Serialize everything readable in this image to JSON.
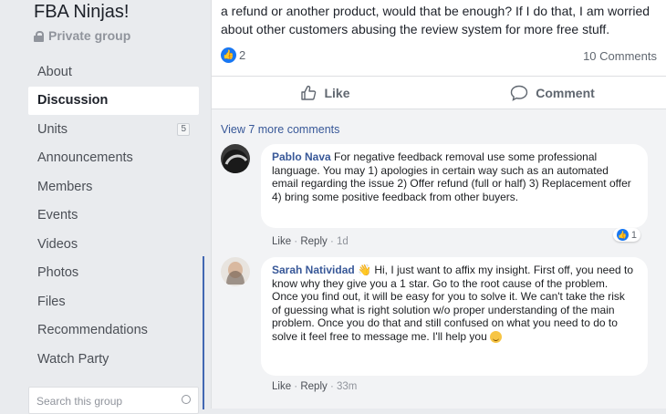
{
  "group": {
    "title": "FBA Ninjas!",
    "privacy": "Private group",
    "nav": [
      {
        "label": "About",
        "active": false
      },
      {
        "label": "Discussion",
        "active": true
      },
      {
        "label": "Units",
        "badge": "5",
        "active": false
      },
      {
        "label": "Announcements",
        "active": false
      },
      {
        "label": "Members",
        "active": false
      },
      {
        "label": "Events",
        "active": false
      },
      {
        "label": "Videos",
        "active": false
      },
      {
        "label": "Photos",
        "active": false
      },
      {
        "label": "Files",
        "active": false
      },
      {
        "label": "Recommendations",
        "active": false
      },
      {
        "label": "Watch Party",
        "active": false
      }
    ],
    "search_placeholder": "Search this group"
  },
  "post": {
    "text": "a refund or another product, would that be enough? If I do that, I am worried about other customers abusing the review system for more free stuff.",
    "reaction_count": "2",
    "comments_count": "10 Comments",
    "like_label": "Like",
    "comment_label": "Comment"
  },
  "comments": {
    "view_more": "View 7 more comments",
    "items": [
      {
        "author": "Pablo Nava",
        "text": "For negative feedback removal use some professional language. You may 1) apologies in certain way such as an automated email regarding the issue 2) Offer refund (full or half) 3) Replacement offer 4) bring some positive feedback from other buyers.",
        "like": "Like",
        "reply": "Reply",
        "time": "1d",
        "reactions": "1"
      },
      {
        "author": "Sarah Natividad",
        "text": "Hi, I just want to affix my insight. First off, you need to know why they give you a 1 star. Go to the root cause of the problem. Once you find out, it will be easy for you to solve it. We can't take the risk of guessing what is right solution w/o proper understanding of the main problem. Once you do that and still confused on what you need to do to solve it feel free to message me. I'll help you",
        "like": "Like",
        "reply": "Reply",
        "time": "33m"
      }
    ]
  }
}
